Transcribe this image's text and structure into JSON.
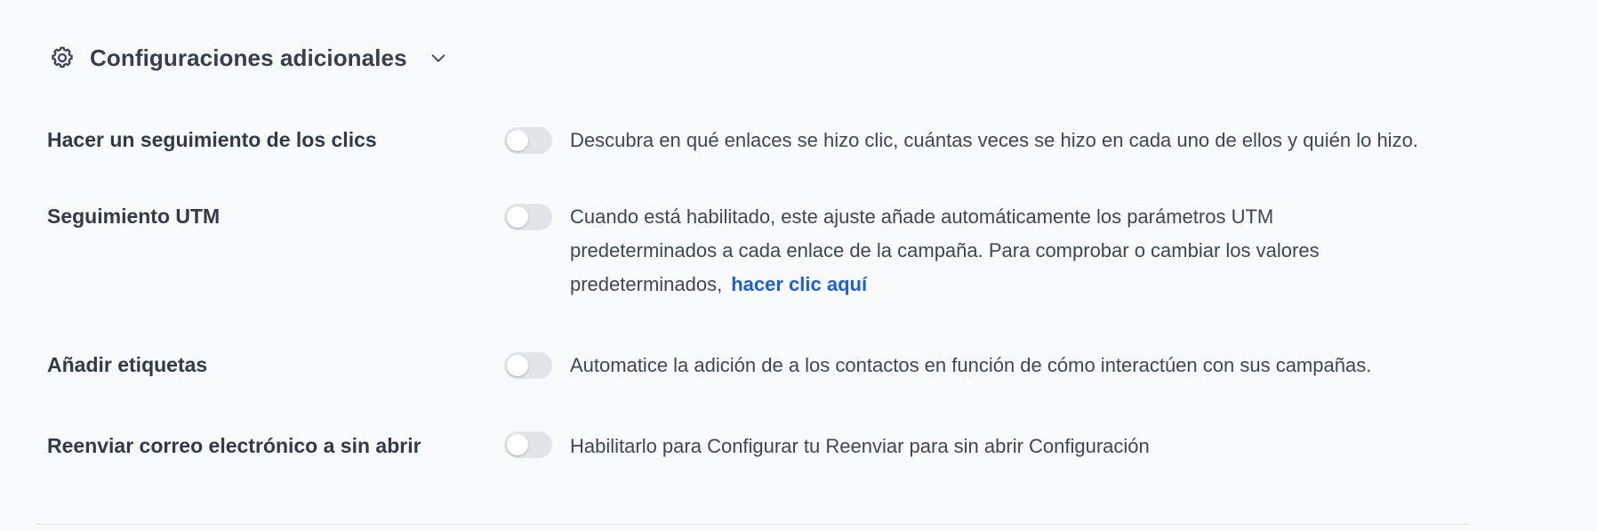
{
  "section": {
    "title": "Configuraciones adicionales",
    "icon": "gear-icon",
    "expand_icon": "chevron-down-icon",
    "expanded": true
  },
  "settings": [
    {
      "label": "Hacer un seguimiento de los clics",
      "enabled": false,
      "description": "Descubra en qué enlaces se hizo clic, cuántas veces se hizo en cada uno de ellos y quién lo hizo."
    },
    {
      "label": "Seguimiento UTM",
      "enabled": false,
      "description": "Cuando está habilitado, este ajuste añade automáticamente los parámetros UTM predeterminados a cada enlace de la campaña. Para comprobar o cambiar los valores predeterminados,",
      "link_label": "hacer clic aquí"
    },
    {
      "label": "Añadir etiquetas",
      "enabled": false,
      "description": "Automatice la adición de a los contactos en función de cómo interactúen con sus campañas."
    },
    {
      "label": "Reenviar correo electrónico a sin abrir",
      "enabled": false,
      "description": "Habilitarlo para Configurar tu Reenviar para sin abrir Configuración"
    }
  ],
  "colors": {
    "background": "#f9fafc",
    "text": "#2f3a4a",
    "link": "#1f5fd1",
    "toggle_off": "#e2e4e9"
  }
}
